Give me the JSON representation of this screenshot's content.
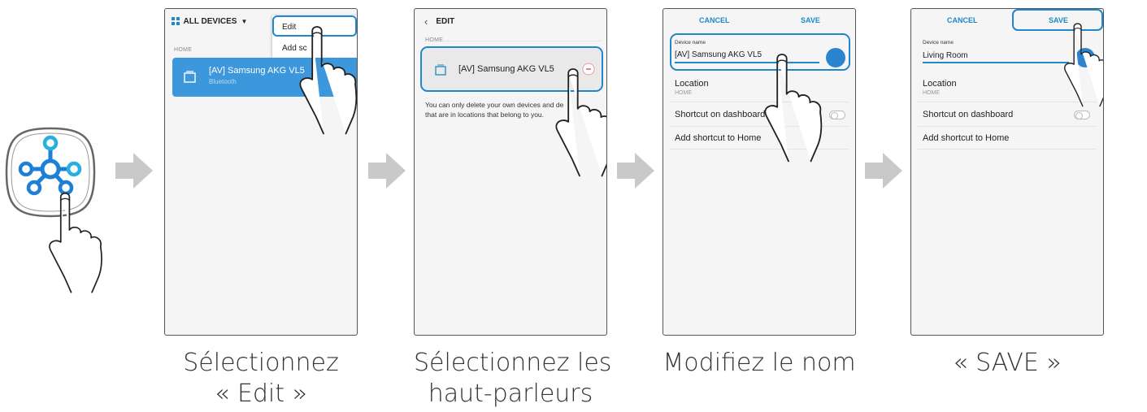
{
  "panel1": {
    "header_title": "ALL DEVICES",
    "menu_edit": "Edit",
    "menu_add": "Add sc",
    "section_label": "HOME",
    "device_name": "[AV] Samsung AKG VL5",
    "device_sub": "Bluetooth"
  },
  "panel2": {
    "header_title": "EDIT",
    "section_label": "HOME",
    "device_name": "[AV] Samsung AKG VL5",
    "note_line1": "You can only delete your own devices and de",
    "note_line2": "that are in locations that belong to you."
  },
  "panel3": {
    "cancel": "CANCEL",
    "save": "SAVE",
    "field_label": "Device name",
    "field_value": "[AV] Samsung AKG VL5",
    "location_label": "Location",
    "location_value": "HOME",
    "shortcut_dashboard": "Shortcut on dashboard",
    "shortcut_home": "Add shortcut to Home"
  },
  "panel4": {
    "cancel": "CANCEL",
    "save": "SAVE",
    "field_label": "Device name",
    "field_value": "Living Room",
    "location_label": "Location",
    "location_value": "HOME",
    "shortcut_dashboard": "Shortcut on dashboard",
    "shortcut_home": "Add shortcut to Home"
  },
  "captions": {
    "c1_line1": "Sélectionnez",
    "c1_line2": "« Edit »",
    "c2_line1": "Sélectionnez les",
    "c2_line2": "haut-parleurs",
    "c3": "Modifiez le nom",
    "c4": "« SAVE »"
  },
  "colors": {
    "accent": "#1e88c8",
    "device_card": "#3d97dc",
    "arrow": "#c9c9c9",
    "app_icon_blue": "#1e7fd6"
  },
  "icons": {
    "app": "smartthings-app-icon",
    "hand": "pointing-hand-icon",
    "grid": "grid-icon",
    "back": "chevron-left-icon",
    "speaker": "speaker-device-icon",
    "remove": "minus-circle-icon"
  }
}
